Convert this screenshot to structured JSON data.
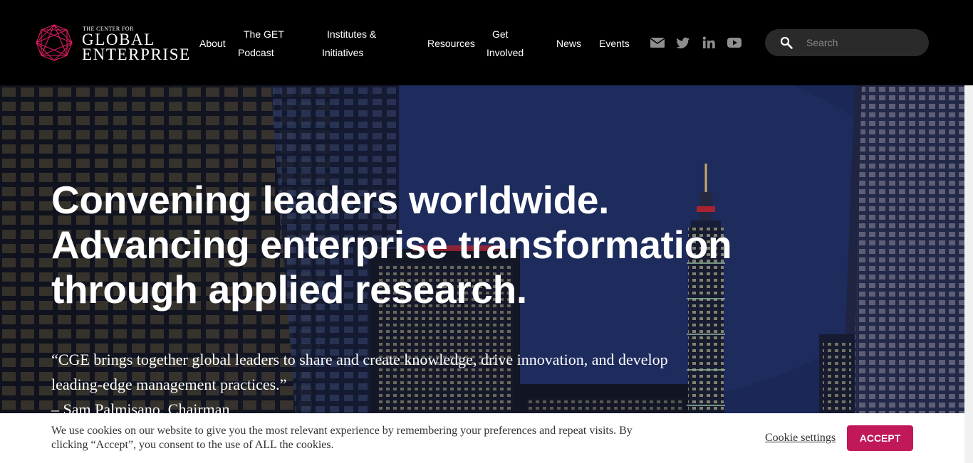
{
  "logo": {
    "small_text": "THE CENTER FOR",
    "line1": "GLOBAL",
    "line2": "ENTERPRISE",
    "icon": "geometric-polygon-logo"
  },
  "nav": {
    "about": "About",
    "podcast": [
      "The GET",
      "Podcast"
    ],
    "institutes": [
      "Institutes &",
      "Initiatives"
    ],
    "resources": "Resources",
    "get_involved": [
      "Get",
      "Involved"
    ],
    "news": "News",
    "events": "Events"
  },
  "social_icons": [
    "email-icon",
    "twitter-icon",
    "linkedin-icon",
    "youtube-icon"
  ],
  "search": {
    "placeholder": "Search",
    "icon": "search-icon"
  },
  "hero": {
    "heading_lines": [
      "Convening leaders worldwide.",
      "Advancing enterprise transformation",
      "through applied research."
    ],
    "quote": "“CGE brings together global leaders to share and create knowledge, drive innovation, and develop leading-edge management practices.”",
    "attribution": "– Sam Palmisano, Chairman"
  },
  "cookie": {
    "text": "We use cookies on our website to give you the most relevant experience by remembering your preferences and repeat visits. By clicking “Accept”, you consent to the use of ALL the cookies.",
    "settings_label": "Cookie settings",
    "accept_label": "ACCEPT"
  },
  "colors": {
    "header_bg": "#000000",
    "accent": "#c1185a",
    "logo_accent": "#d81b60",
    "hero_sky": "#253a7d",
    "search_bg": "#2a2a2a"
  }
}
